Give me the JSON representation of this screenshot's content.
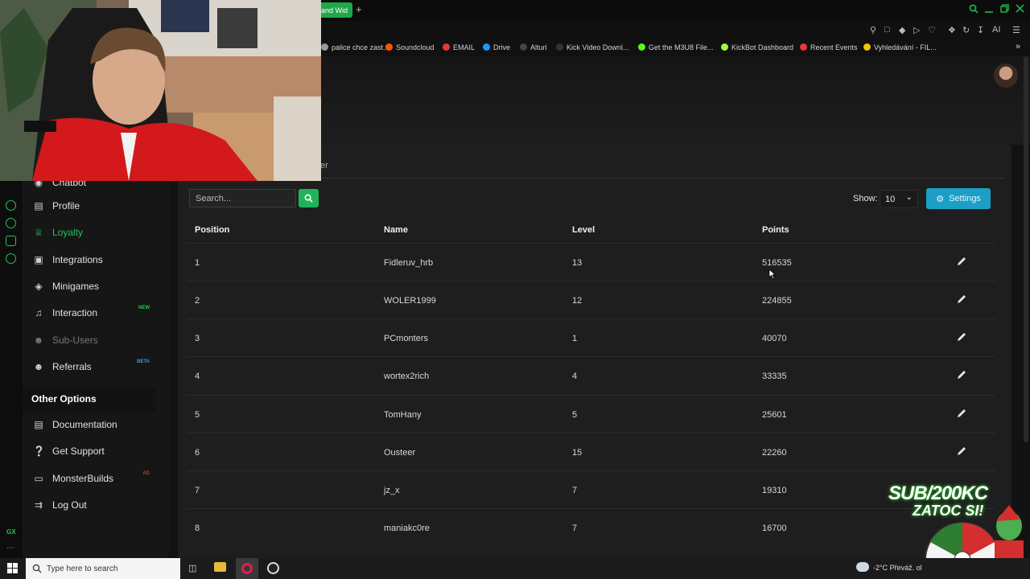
{
  "browser": {
    "active_tab_label": "and Wid",
    "new_tab_symbol": "+",
    "bookmarks": [
      {
        "label": "palice chce zast...",
        "color": "#999999"
      },
      {
        "label": "Soundcloud",
        "color": "#ff5500"
      },
      {
        "label": "EMAIL",
        "color": "#e53935"
      },
      {
        "label": "Drive",
        "color": "#2196f3"
      },
      {
        "label": "Alturi",
        "color": "#444444"
      },
      {
        "label": "Kick Video Downl...",
        "color": "#333333"
      },
      {
        "label": "Get the M3U8 File...",
        "color": "#53fc18"
      },
      {
        "label": "KickBot Dashboard",
        "color": "#9bff3a"
      },
      {
        "label": "Recent Events",
        "color": "#e53935"
      },
      {
        "label": "Vyhledávání - FIL...",
        "color": "#f5c400"
      }
    ],
    "toolbar_ai_label": "AI"
  },
  "content": {
    "partial_tab_label": "er",
    "search_placeholder": "Search...",
    "show_label": "Show:",
    "show_value": "10",
    "settings_label": "Settings"
  },
  "sidebar": {
    "partial_item_label": "Chatbot",
    "items": [
      {
        "label": "Profile",
        "icon": "id-card-icon",
        "state": "normal"
      },
      {
        "label": "Loyalty",
        "icon": "trophy-icon",
        "state": "active"
      },
      {
        "label": "Integrations",
        "icon": "puzzle-icon",
        "state": "normal"
      },
      {
        "label": "Minigames",
        "icon": "gamepad-icon",
        "state": "normal"
      },
      {
        "label": "Interaction",
        "icon": "music-icon",
        "state": "normal",
        "badge": "NEW",
        "badge_color": "#21c45a"
      },
      {
        "label": "Sub-Users",
        "icon": "users-icon",
        "state": "disabled"
      },
      {
        "label": "Referrals",
        "icon": "user-group-icon",
        "state": "normal",
        "badge": "BETA",
        "badge_color": "#3a9ad9"
      }
    ],
    "other_options_title": "Other Options",
    "other_items": [
      {
        "label": "Documentation",
        "icon": "book-icon"
      },
      {
        "label": "Get Support",
        "icon": "question-icon"
      },
      {
        "label": "MonsterBuilds",
        "icon": "laptop-icon",
        "badge": "AD",
        "badge_color": "#c0392b"
      },
      {
        "label": "Log Out",
        "icon": "logout-icon"
      }
    ]
  },
  "opera_bar": {
    "gx_label": "GX"
  },
  "table": {
    "headers": [
      "Position",
      "Name",
      "Level",
      "Points"
    ],
    "rows": [
      {
        "position": "1",
        "name": "Fidleruv_hrb",
        "level": "13",
        "points": "516535"
      },
      {
        "position": "2",
        "name": "WOLER1999",
        "level": "12",
        "points": "224855"
      },
      {
        "position": "3",
        "name": "PCmonters",
        "level": "1",
        "points": "40070"
      },
      {
        "position": "4",
        "name": "wortex2rich",
        "level": "4",
        "points": "33335"
      },
      {
        "position": "5",
        "name": "TomHany",
        "level": "5",
        "points": "25601"
      },
      {
        "position": "6",
        "name": "Ousteer",
        "level": "15",
        "points": "22260"
      },
      {
        "position": "7",
        "name": "jz_x",
        "level": "7",
        "points": "19310"
      },
      {
        "position": "8",
        "name": "maniakc0re",
        "level": "7",
        "points": "16700"
      }
    ]
  },
  "overlay": {
    "promo_line1": "SUB/200KC",
    "promo_line2": "ZATOC SI!"
  },
  "taskbar": {
    "search_placeholder": "Type here to search",
    "weather": "-2°C  Převáž. ol"
  }
}
